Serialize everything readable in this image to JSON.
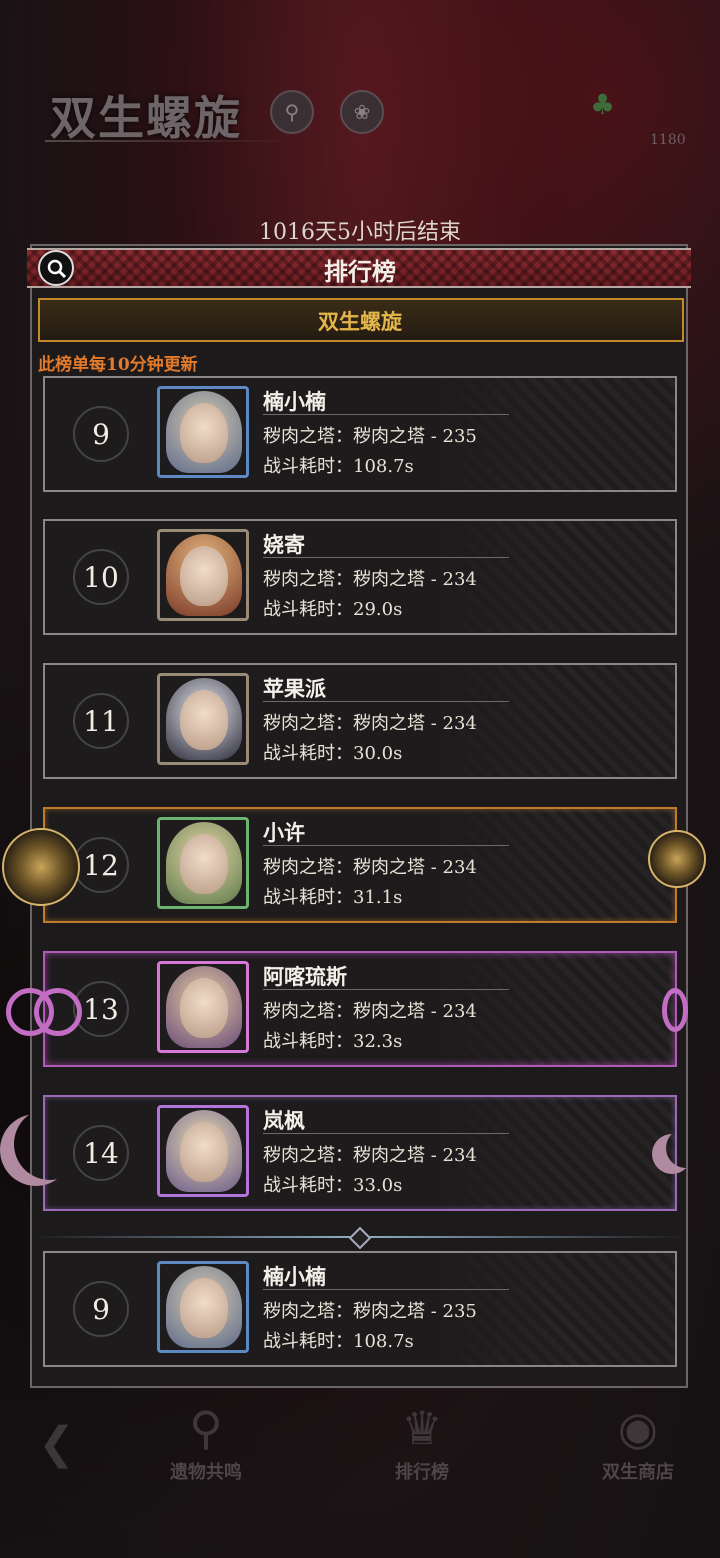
{
  "header": {
    "game_title": "双生螺旋",
    "countdown": "1016天5小时后结束",
    "resource_value": "1180"
  },
  "panel": {
    "title": "排行榜",
    "subtab": "双生螺旋",
    "notice": "此榜单每10分钟更新"
  },
  "rows": [
    {
      "rank": "9",
      "name": "楠小楠",
      "stage": "秽肉之塔：秽肉之塔 - 235",
      "time": "战斗耗时：108.7s"
    },
    {
      "rank": "10",
      "name": "娆寄",
      "stage": "秽肉之塔：秽肉之塔 - 234",
      "time": "战斗耗时：29.0s"
    },
    {
      "rank": "11",
      "name": "苹果派",
      "stage": "秽肉之塔：秽肉之塔 - 234",
      "time": "战斗耗时：30.0s"
    },
    {
      "rank": "12",
      "name": "小许",
      "stage": "秽肉之塔：秽肉之塔 - 234",
      "time": "战斗耗时：31.1s"
    },
    {
      "rank": "13",
      "name": "阿喀琉斯",
      "stage": "秽肉之塔：秽肉之塔 - 234",
      "time": "战斗耗时：32.3s"
    },
    {
      "rank": "14",
      "name": "岚枫",
      "stage": "秽肉之塔：秽肉之塔 - 234",
      "time": "战斗耗时：33.0s"
    }
  ],
  "my_row": {
    "rank": "9",
    "name": "楠小楠",
    "stage": "秽肉之塔：秽肉之塔 - 235",
    "time": "战斗耗时：108.7s"
  },
  "nav": {
    "item1": "遗物共鸣",
    "item2": "排行榜",
    "item3": "双生商店"
  },
  "colors": {
    "accent_gold": "#e5b64a",
    "notice_orange": "#e27a2b",
    "header_red": "#8a2b30"
  }
}
